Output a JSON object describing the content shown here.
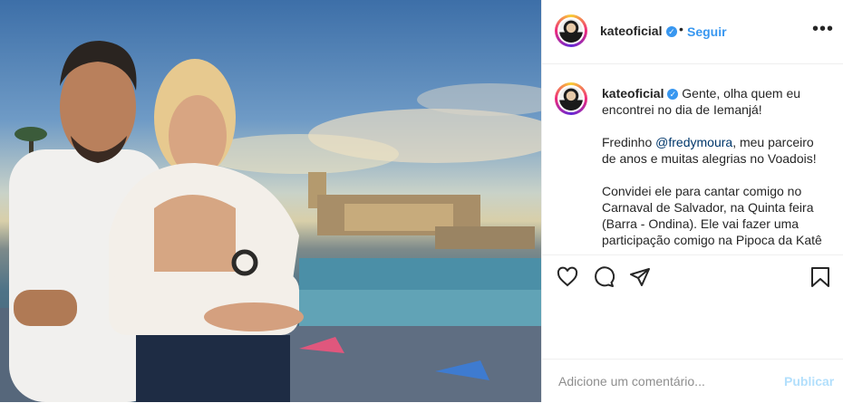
{
  "post": {
    "username": "kateoficial",
    "verified_badge": "verified-badge-icon",
    "separator": "•",
    "follow_label": "Seguir",
    "more_label": "•••",
    "caption": {
      "line1_text": "Gente, olha quem eu encontrei no dia de Iemanjá!",
      "p2_before": "Fredinho ",
      "p2_mention": "@fredymoura",
      "p2_after": ", meu parceiro de anos e muitas alegrias no Voadois!",
      "p3": "Convidei ele para cantar comigo no Carnaval de Salvador, na Quinta feira (Barra - Ondina). Ele vai fazer uma participação comigo na Pipoca da Katê"
    }
  },
  "actions": {
    "like_icon": "heart-icon",
    "comment_icon": "comment-bubble-icon",
    "share_icon": "paper-plane-icon",
    "save_icon": "bookmark-icon"
  },
  "comment_box": {
    "placeholder": "Adicione um comentário...",
    "publish_label": "Publicar"
  },
  "colors": {
    "link_blue": "#3897f0",
    "publish_disabled": "#b2dffc",
    "mention": "#00376b"
  }
}
